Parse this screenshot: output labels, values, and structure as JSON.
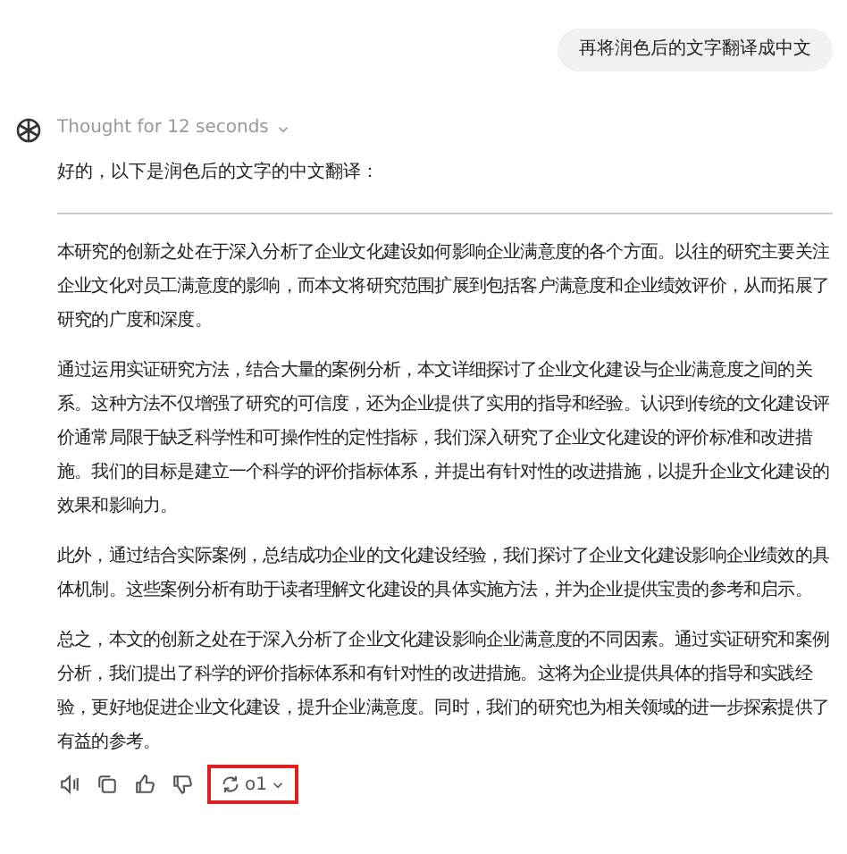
{
  "user_message": {
    "text": "再将润色后的文字翻译成中文"
  },
  "assistant": {
    "thought": {
      "label": "Thought for 12 seconds",
      "expanded": false
    },
    "intro": "好的，以下是润色后的文字的中文翻译：",
    "paragraphs": [
      "本研究的创新之处在于深入分析了企业文化建设如何影响企业满意度的各个方面。以往的研究主要关注企业文化对员工满意度的影响，而本文将研究范围扩展到包括客户满意度和企业绩效评价，从而拓展了研究的广度和深度。",
      "通过运用实证研究方法，结合大量的案例分析，本文详细探讨了企业文化建设与企业满意度之间的关系。这种方法不仅增强了研究的可信度，还为企业提供了实用的指导和经验。认识到传统的文化建设评价通常局限于缺乏科学性和可操作性的定性指标，我们深入研究了企业文化建设的评价标准和改进措施。我们的目标是建立一个科学的评价指标体系，并提出有针对性的改进措施，以提升企业文化建设的效果和影响力。",
      "此外，通过结合实际案例，总结成功企业的文化建设经验，我们探讨了企业文化建设影响企业绩效的具体机制。这些案例分析有助于读者理解文化建设的具体实施方法，并为企业提供宝贵的参考和启示。",
      "总之，本文的创新之处在于深入分析了企业文化建设影响企业满意度的不同因素。通过实证研究和案例分析，我们提出了科学的评价指标体系和有针对性的改进措施。这将为企业提供具体的指导和实践经验，更好地促进企业文化建设，提升企业满意度。同时，我们的研究也为相关领域的进一步探索提供了有益的参考。"
    ]
  },
  "toolbar": {
    "actions": [
      {
        "kind": "speaker"
      },
      {
        "kind": "copy"
      },
      {
        "kind": "thumbs_up"
      },
      {
        "kind": "thumbs_down"
      }
    ],
    "model_switch": {
      "label": "o1",
      "highlighted": true
    }
  }
}
